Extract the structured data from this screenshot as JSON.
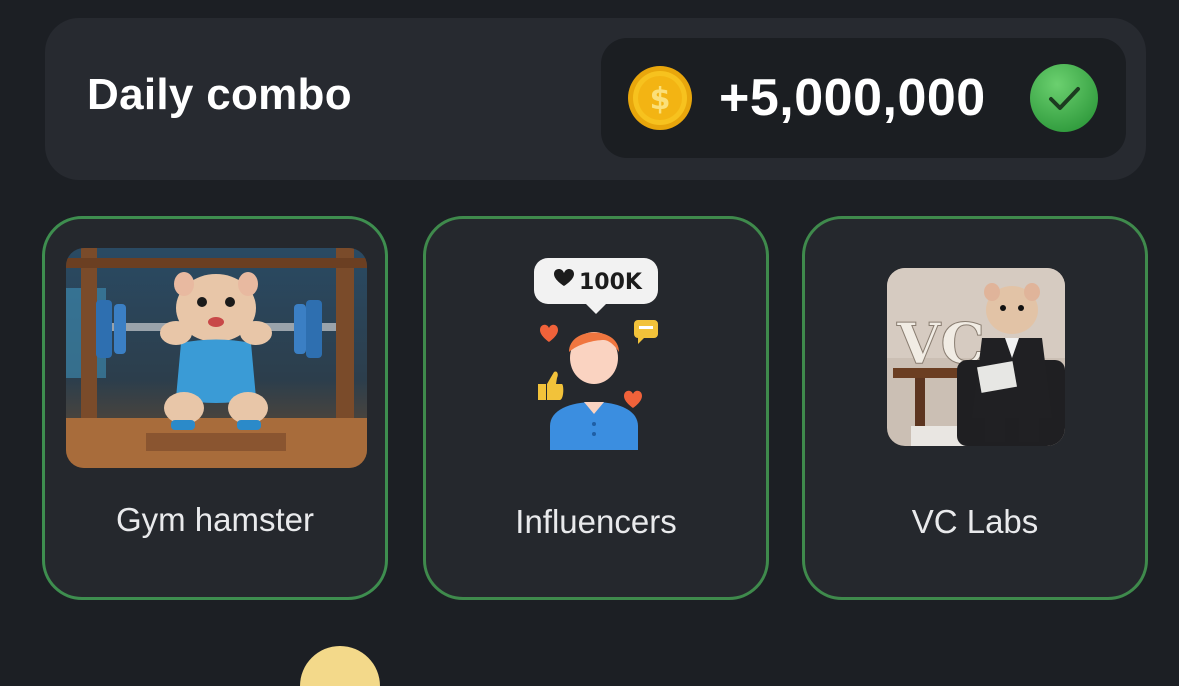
{
  "header": {
    "title": "Daily combo",
    "reward_amount": "+5,000,000",
    "coin_icon": "coin-dollar-icon",
    "status_icon": "check-circle-icon"
  },
  "cards": [
    {
      "label": "Gym hamster",
      "image": "gym-hamster-image",
      "completed": true
    },
    {
      "label": "Influencers",
      "image": "influencer-icon",
      "completed": true
    },
    {
      "label": "VC Labs",
      "image": "vc-labs-hamster-image",
      "completed": true
    }
  ],
  "colors": {
    "background": "#1c1f24",
    "panel": "#272a30",
    "card_border": "#3e8e4f",
    "check_green": "#3fae4f",
    "coin_gold": "#f4b818"
  }
}
